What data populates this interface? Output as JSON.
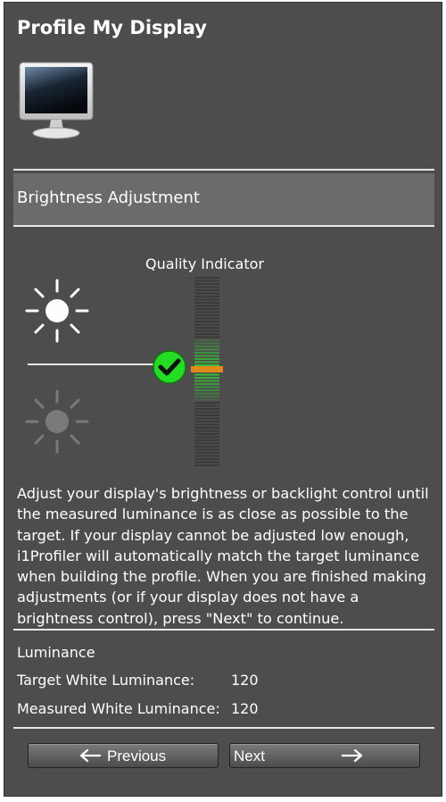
{
  "window": {
    "title": "Profile My Display"
  },
  "icons": {
    "monitor": "display-monitor-icon",
    "bright": "sun-bright-icon",
    "dim": "sun-dim-icon",
    "check": "checkmark-icon",
    "prev_arrow": "arrow-left-icon",
    "next_arrow": "arrow-right-icon"
  },
  "section": {
    "title": "Brightness Adjustment"
  },
  "indicator": {
    "label": "Quality Indicator",
    "status": "ok",
    "colors": {
      "good": "#33cc33",
      "marker": "#e08a1a",
      "knob": "#22dd22"
    }
  },
  "instructions": "Adjust your display's brightness or backlight control until the measured luminance is as close as possible to the target.  If your display cannot be adjusted low enough, i1Profiler will automatically match the target luminance when building the profile.  When you are finished making adjustments (or if your display does not have a brightness control), press \"Next\" to continue.",
  "luminance": {
    "heading": "Luminance",
    "target_label": "Target White Luminance:",
    "target_value": "120",
    "measured_label": "Measured White Luminance:",
    "measured_value": "120"
  },
  "nav": {
    "previous_label": "Previous",
    "next_label": "Next"
  }
}
